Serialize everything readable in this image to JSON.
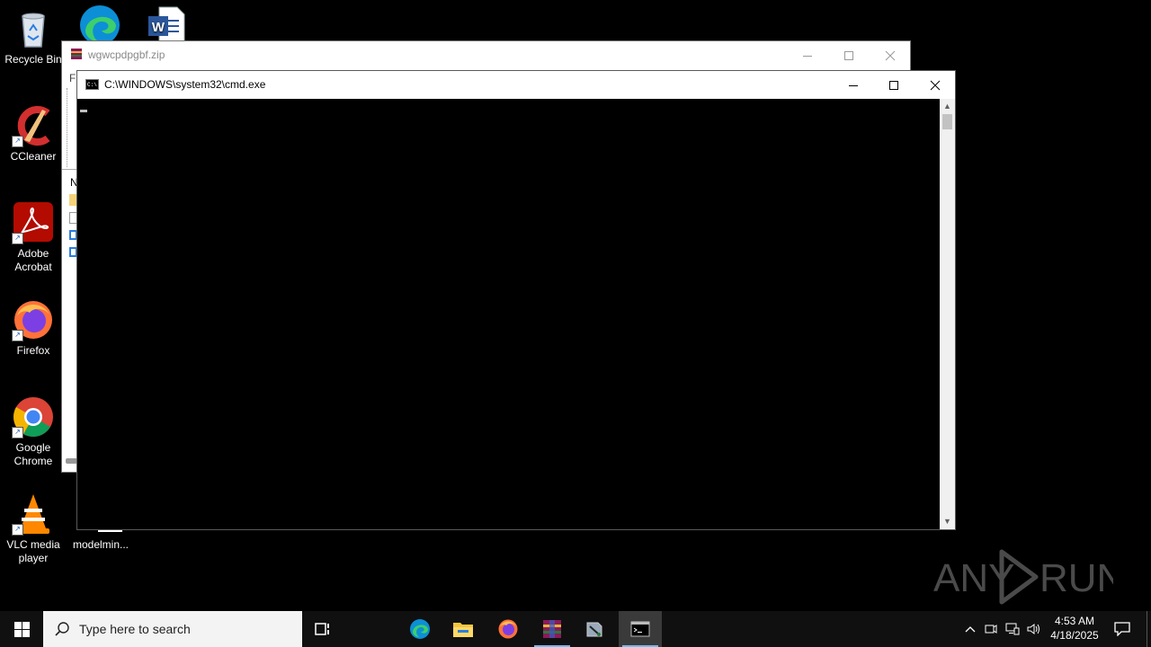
{
  "desktop": {
    "icons": [
      {
        "label": "Recycle Bin"
      },
      {
        "label": "CCleaner"
      },
      {
        "label": "Adobe Acrobat"
      },
      {
        "label": "Firefox"
      },
      {
        "label": "Google Chrome"
      },
      {
        "label": "VLC media player"
      },
      {
        "label": "modelmin..."
      }
    ]
  },
  "winrar_window": {
    "title": "wgwcpdpgbf.zip",
    "menu_first": "Fi",
    "column_first": "N"
  },
  "cmd_window": {
    "title": "C:\\WINDOWS\\system32\\cmd.exe"
  },
  "watermark": {
    "text": "ANY RUN"
  },
  "taskbar": {
    "search_placeholder": "Type here to search",
    "clock_time": "4:53 AM",
    "clock_date": "4/18/2025",
    "apps": [
      "task-view",
      "edge",
      "file-explorer",
      "firefox",
      "winrar",
      "tool",
      "cmd"
    ]
  }
}
